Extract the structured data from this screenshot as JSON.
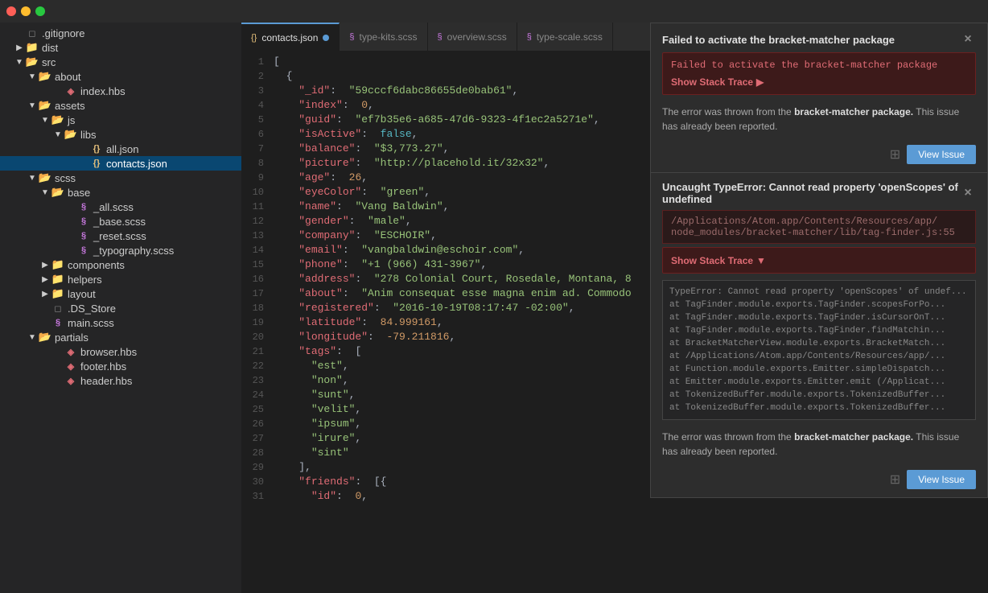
{
  "titlebar": {
    "buttons": [
      "close",
      "minimize",
      "maximize"
    ]
  },
  "tabs": [
    {
      "id": "contacts-json",
      "label": "contacts.json",
      "icon": "json",
      "active": true,
      "modified": true
    },
    {
      "id": "type-kits-scss",
      "label": "type-kits.scss",
      "icon": "scss",
      "active": false,
      "modified": false
    },
    {
      "id": "overview-scss",
      "label": "overview.scss",
      "icon": "scss",
      "active": false,
      "modified": false
    },
    {
      "id": "type-scale-scss",
      "label": "type-scale.scss",
      "icon": "scss",
      "active": false,
      "modified": false
    }
  ],
  "sidebar": {
    "items": [
      {
        "id": "gitignore",
        "label": ".gitignore",
        "type": "file",
        "depth": 0,
        "expanded": false
      },
      {
        "id": "dist",
        "label": "dist",
        "type": "folder",
        "depth": 0,
        "expanded": false
      },
      {
        "id": "src",
        "label": "src",
        "type": "folder",
        "depth": 0,
        "expanded": true
      },
      {
        "id": "about",
        "label": "about",
        "type": "folder",
        "depth": 1,
        "expanded": true
      },
      {
        "id": "index-hbs",
        "label": "index.hbs",
        "type": "file-hbs",
        "depth": 2,
        "expanded": false
      },
      {
        "id": "assets",
        "label": "assets",
        "type": "folder",
        "depth": 1,
        "expanded": true
      },
      {
        "id": "js",
        "label": "js",
        "type": "folder",
        "depth": 2,
        "expanded": true
      },
      {
        "id": "libs",
        "label": "libs",
        "type": "folder",
        "depth": 3,
        "expanded": true
      },
      {
        "id": "all-json",
        "label": "all.json",
        "type": "file-json",
        "depth": 4,
        "expanded": false
      },
      {
        "id": "contacts-json",
        "label": "contacts.json",
        "type": "file-json",
        "depth": 4,
        "expanded": false,
        "active": true
      },
      {
        "id": "scss",
        "label": "scss",
        "type": "folder",
        "depth": 1,
        "expanded": true
      },
      {
        "id": "base",
        "label": "base",
        "type": "folder",
        "depth": 2,
        "expanded": true
      },
      {
        "id": "all-scss",
        "label": "_all.scss",
        "type": "file-scss",
        "depth": 3,
        "expanded": false
      },
      {
        "id": "base-scss",
        "label": "_base.scss",
        "type": "file-scss",
        "depth": 3,
        "expanded": false
      },
      {
        "id": "reset-scss",
        "label": "_reset.scss",
        "type": "file-scss",
        "depth": 3,
        "expanded": false
      },
      {
        "id": "typography-scss",
        "label": "_typography.scss",
        "type": "file-scss",
        "depth": 3,
        "expanded": false
      },
      {
        "id": "components",
        "label": "components",
        "type": "folder",
        "depth": 2,
        "expanded": false
      },
      {
        "id": "helpers",
        "label": "helpers",
        "type": "folder",
        "depth": 2,
        "expanded": false
      },
      {
        "id": "layout",
        "label": "layout",
        "type": "folder",
        "depth": 2,
        "expanded": false
      },
      {
        "id": "ds-store",
        "label": ".DS_Store",
        "type": "file-misc",
        "depth": 2,
        "expanded": false
      },
      {
        "id": "main-scss",
        "label": "main.scss",
        "type": "file-scss",
        "depth": 2,
        "expanded": false
      },
      {
        "id": "partials",
        "label": "partials",
        "type": "folder",
        "depth": 1,
        "expanded": true
      },
      {
        "id": "browser-hbs",
        "label": "browser.hbs",
        "type": "file-hbs",
        "depth": 2,
        "expanded": false
      },
      {
        "id": "footer-hbs",
        "label": "footer.hbs",
        "type": "file-hbs",
        "depth": 2,
        "expanded": false
      },
      {
        "id": "header-hbs",
        "label": "header.hbs",
        "type": "file-hbs",
        "depth": 2,
        "expanded": false
      }
    ]
  },
  "code": {
    "lines": [
      {
        "num": 1,
        "content": "["
      },
      {
        "num": 2,
        "content": "  {"
      },
      {
        "num": 3,
        "content": "    \"_id\":  \"59cccf6dabc86655de0bab61\","
      },
      {
        "num": 4,
        "content": "    \"index\":  0,"
      },
      {
        "num": 5,
        "content": "    \"guid\":  \"ef7b35e6-a685-47d6-9323-4f1ec2a5271e\","
      },
      {
        "num": 6,
        "content": "    \"isActive\":  false,"
      },
      {
        "num": 7,
        "content": "    \"balance\":  \"$3,773.27\","
      },
      {
        "num": 8,
        "content": "    \"picture\":  \"http://placehold.it/32x32\","
      },
      {
        "num": 9,
        "content": "    \"age\":  26,"
      },
      {
        "num": 10,
        "content": "    \"eyeColor\":  \"green\","
      },
      {
        "num": 11,
        "content": "    \"name\":  \"Vang Baldwin\","
      },
      {
        "num": 12,
        "content": "    \"gender\":  \"male\","
      },
      {
        "num": 13,
        "content": "    \"company\":  \"ESCHOIR\","
      },
      {
        "num": 14,
        "content": "    \"email\":  \"vangbaldwin@eschoir.com\","
      },
      {
        "num": 15,
        "content": "    \"phone\":  \"+1 (966) 431-3967\","
      },
      {
        "num": 16,
        "content": "    \"address\":  \"278 Colonial Court, Rosedale, Montana, 8"
      },
      {
        "num": 17,
        "content": "    \"about\":  \"Anim consequat esse magna enim ad. Commodo"
      },
      {
        "num": 18,
        "content": "    \"registered\":  \"2016-10-19T08:17:47 -02:00\","
      },
      {
        "num": 19,
        "content": "    \"latitude\":  84.999161,"
      },
      {
        "num": 20,
        "content": "    \"longitude\":  -79.211816,"
      },
      {
        "num": 21,
        "content": "    \"tags\":  ["
      },
      {
        "num": 22,
        "content": "      \"est\","
      },
      {
        "num": 23,
        "content": "      \"non\","
      },
      {
        "num": 24,
        "content": "      \"sunt\","
      },
      {
        "num": 25,
        "content": "      \"velit\","
      },
      {
        "num": 26,
        "content": "      \"ipsum\","
      },
      {
        "num": 27,
        "content": "      \"irure\","
      },
      {
        "num": 28,
        "content": "      \"sint\""
      },
      {
        "num": 29,
        "content": "    ],"
      },
      {
        "num": 30,
        "content": "    \"friends\":  [{"
      },
      {
        "num": 31,
        "content": "      \"id\":  0,"
      }
    ]
  },
  "notifications": {
    "panel1": {
      "title": "Failed to activate the bracket-matcher package",
      "error_text": "Failed to activate the bracket-matcher package",
      "show_stack_trace": "Show Stack Trace",
      "body_text": "The error was thrown from the ",
      "package_name": "bracket-matcher package.",
      "body_text2": " This issue has already been reported.",
      "view_issue_label": "View Issue"
    },
    "panel2": {
      "title": "Uncaught TypeError: Cannot read property 'openScopes' of undefined",
      "error_path": "/Applications/Atom.app/Contents/Resources/app/\nnode_modules/bracket-matcher/lib/tag-finder.js:55",
      "show_stack_trace": "Show Stack Trace",
      "stack_lines": [
        "TypeError: Cannot read property 'openScopes' of undef...",
        "    at TagFinder.module.exports.TagFinder.scopesForPo...",
        "    at TagFinder.module.exports.TagFinder.isCursorOnT...",
        "    at TagFinder.module.exports.TagFinder.findMatchin...",
        "    at BracketMatcherView.module.exports.BracketMatch...",
        "    at /Applications/Atom.app/Contents/Resources/app/...",
        "    at Function.module.exports.Emitter.simpleDispatch...",
        "    at Emitter.module.exports.Emitter.emit (/Applicat...",
        "    at TokenizedBuffer.module.exports.TokenizedBuffer...",
        "    at TokenizedBuffer.module.exports.TokenizedBuffer..."
      ],
      "body_text": "The error was thrown from the ",
      "package_name": "bracket-matcher package.",
      "body_text2": " This issue has already been reported.",
      "view_issue_label": "View Issue"
    }
  }
}
